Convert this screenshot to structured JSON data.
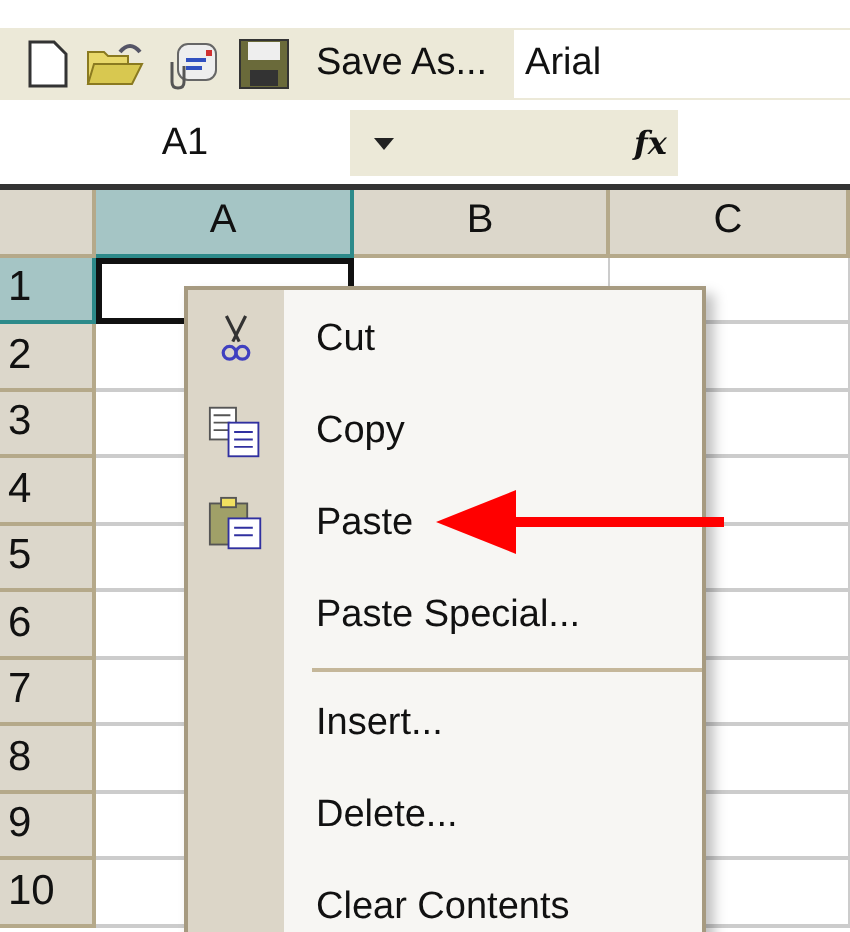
{
  "toolbar": {
    "icons": [
      {
        "kind": "new"
      },
      {
        "kind": "open"
      },
      {
        "kind": "mail"
      },
      {
        "kind": "save"
      }
    ],
    "save_as": {
      "label": "Save As..."
    },
    "font_box": {
      "value": "Arial"
    }
  },
  "formula_bar": {
    "name_box": "A1",
    "fx_label": "fx"
  },
  "columns": [
    {
      "label": "A",
      "selected": true
    },
    {
      "label": "B",
      "selected": false
    },
    {
      "label": "C",
      "selected": false
    }
  ],
  "rows": [
    {
      "label": "1",
      "selected": true
    },
    {
      "label": "2",
      "selected": false
    },
    {
      "label": "3",
      "selected": false
    },
    {
      "label": "4",
      "selected": false
    },
    {
      "label": "5",
      "selected": false
    },
    {
      "label": "6",
      "selected": false
    },
    {
      "label": "7",
      "selected": false
    },
    {
      "label": "8",
      "selected": false
    },
    {
      "label": "9",
      "selected": false
    },
    {
      "label": "10",
      "selected": false
    }
  ],
  "context_menu": {
    "items": [
      {
        "kind": "cut",
        "label": "Cut"
      },
      {
        "kind": "copy",
        "label": "Copy"
      },
      {
        "kind": "paste",
        "label": "Paste"
      },
      {
        "kind": "item",
        "label": "Paste Special..."
      },
      {
        "kind": "separator"
      },
      {
        "kind": "item",
        "label": "Insert..."
      },
      {
        "kind": "item",
        "label": "Delete..."
      },
      {
        "kind": "item",
        "label": "Clear Contents"
      }
    ]
  }
}
